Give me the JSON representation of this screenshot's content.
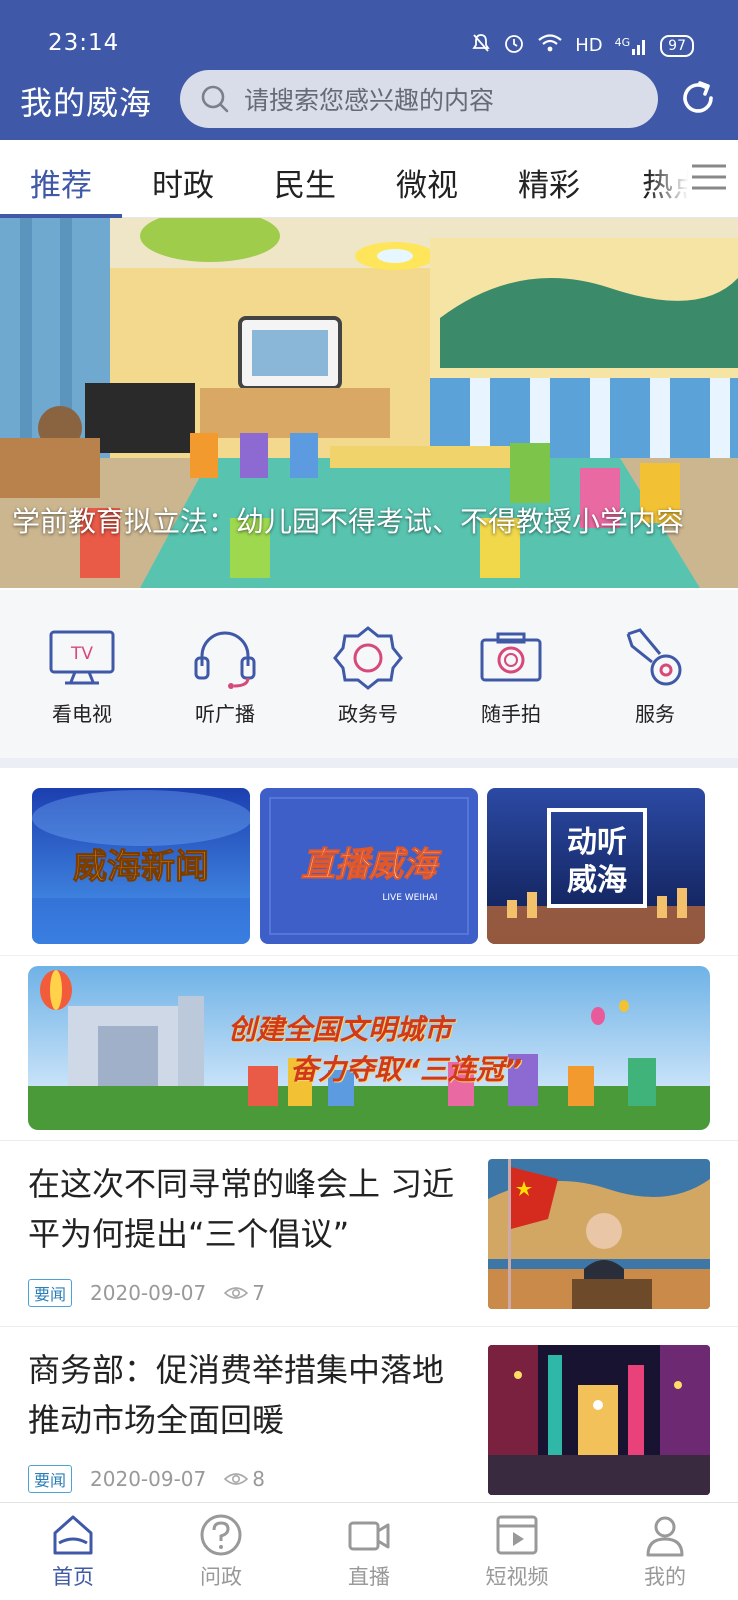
{
  "status_bar": {
    "time": "23:14",
    "network": "HD",
    "signal": "4G",
    "battery": "97"
  },
  "header": {
    "logo": "我的威海",
    "search_placeholder": "请搜索您感兴趣的内容",
    "icons": [
      "search-icon",
      "refresh-icon"
    ]
  },
  "tabs": [
    {
      "label": "推荐",
      "active": true
    },
    {
      "label": "时政"
    },
    {
      "label": "民生"
    },
    {
      "label": "微视"
    },
    {
      "label": "精彩"
    },
    {
      "label": "热点"
    }
  ],
  "hero": {
    "caption": "学前教育拟立法：幼儿园不得考试、不得教授小学内容"
  },
  "quick_entries": [
    {
      "label": "看电视",
      "icon": "tv-icon",
      "icon_text": "TV"
    },
    {
      "label": "听广播",
      "icon": "headphones-icon"
    },
    {
      "label": "政务号",
      "icon": "badge-icon"
    },
    {
      "label": "随手拍",
      "icon": "camera-icon"
    },
    {
      "label": "服务",
      "icon": "key-icon"
    }
  ],
  "channels": [
    {
      "label": "威海新闻"
    },
    {
      "label": "直播威海",
      "sub": "LIVE WEIHAI"
    },
    {
      "label_line1": "动听",
      "label_line2": "威海"
    }
  ],
  "campaign": {
    "line1": "创建全国文明城市",
    "line2": "奋力夺取“三连冠”"
  },
  "news": [
    {
      "title": "在这次不同寻常的峰会上 习近平为何提出“三个倡议”",
      "tag": "要闻",
      "date": "2020-09-07",
      "views": "7"
    },
    {
      "title": "商务部：促消费举措集中落地 推动市场全面回暖",
      "tag": "要闻",
      "date": "2020-09-07",
      "views": "8"
    }
  ],
  "bottom_nav": [
    {
      "label": "首页",
      "icon": "home-icon",
      "active": true
    },
    {
      "label": "问政",
      "icon": "question-icon"
    },
    {
      "label": "直播",
      "icon": "video-camera-icon"
    },
    {
      "label": "短视频",
      "icon": "short-video-icon"
    },
    {
      "label": "我的",
      "icon": "user-icon"
    }
  ],
  "colors": {
    "primary": "#3f59a8",
    "tag_border": "#4aa3d6",
    "inactive": "#999999"
  }
}
